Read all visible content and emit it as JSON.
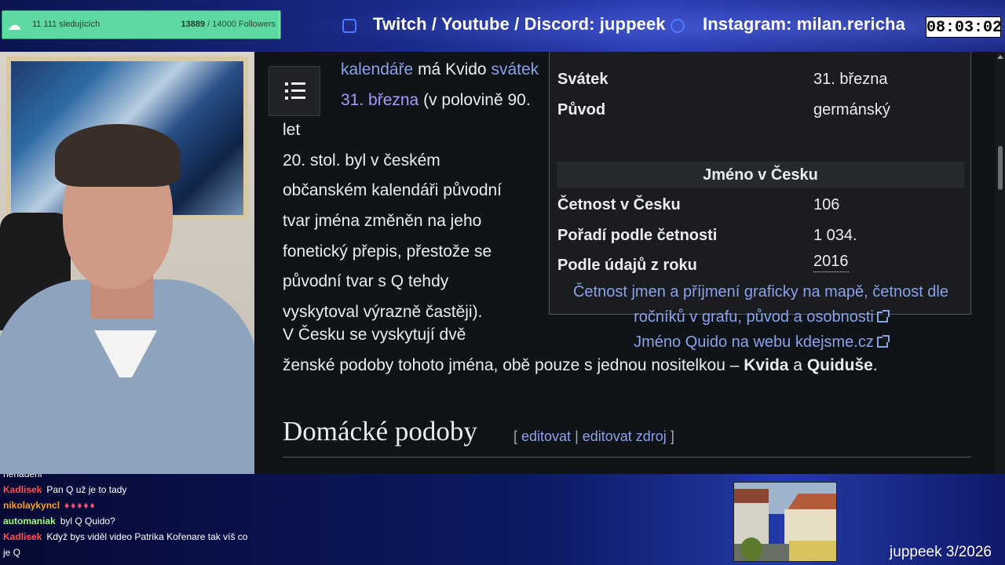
{
  "overlay": {
    "followers_goal": {
      "title": "11 111 sledujících",
      "current": "13889",
      "goal_text": " / 14000 Followers",
      "progress_fraction": 0.992
    },
    "social_twitch": "Twitch / Youtube / Discord: juppeek",
    "social_instagram": "Instagram: milan.rericha",
    "clock": "08:03:02",
    "footer_tag": "juppeek 3/2026"
  },
  "wiki": {
    "para1": {
      "l1a": "kalendáře",
      "l1b": " má Kvido ",
      "l1c": "svátek",
      "l2a": "31. března",
      "l2b": " (v polovině 90. let",
      "l3": "20. stol. byl v českém",
      "l4": "občanském kalendáři původní",
      "l5": "tvar jména změněn na jeho",
      "l6": "fonetický přepis, přestože se",
      "l7": "původní tvar s Q tehdy",
      "l8": "vyskytoval výrazně častěji)."
    },
    "para2": {
      "l1": "V Česku se vyskytují dvě",
      "l2a": "ženské podoby tohoto jména, obě pouze s jednou nositelkou – ",
      "l2b": "Kvida",
      "l2c": " a ",
      "l2d": "Quiduše",
      "l2e": "."
    },
    "heading": "Domácké podoby",
    "heading_edit": {
      "open": "[ ",
      "edit": "editovat",
      "sep": " | ",
      "edit_source": "editovat zdroj",
      "close": " ]"
    },
    "infobox": {
      "rows_top": [
        {
          "label": "Svátek",
          "value": "31. března"
        },
        {
          "label": "Původ",
          "value": "germánský"
        }
      ],
      "section_header": "Jméno v Česku",
      "rows_bottom": [
        {
          "label": "Četnost v Česku",
          "value": "106"
        },
        {
          "label": "Pořadí podle četnosti",
          "value": "1 034."
        },
        {
          "label": "Podle údajů z roku",
          "value": "2016"
        }
      ],
      "link1a": "Četnost jmen a příjmení graficky na mapě, četnost dle",
      "link1b": "ročníků v grafu, původ a osobnosti",
      "link2": "Jméno Quido na webu kdejsme.cz"
    }
  },
  "chat": {
    "messages": [
      {
        "user": "",
        "text": "nenadeni",
        "user_color": "#ff5a5a"
      },
      {
        "user": "Kadlisek",
        "text": "Pan Q už je to tady",
        "user_color": "#ff4d4d"
      },
      {
        "user": "nikolaykyncl",
        "text": "",
        "hearts": "♦♦♦♦♦",
        "user_color": "#ff9f1a"
      },
      {
        "user": "automaniak",
        "text": "byl Q Quido?",
        "user_color": "#9aff7a"
      },
      {
        "user": "Kadlisek",
        "text": "Když bys viděl video Patrika Kořenare tak víš co je Q",
        "user_color": "#ff4d4d"
      }
    ]
  },
  "colors": {
    "accent_green": "#6fe6b2",
    "wiki_link": "#88a3e8",
    "wiki_bg": "#101418",
    "overlay_blue": "#2c3fb5"
  },
  "icons": [
    "scratch-icon",
    "twitch-icon",
    "instagram-icon",
    "toc-list-icon",
    "external-link-icon"
  ]
}
